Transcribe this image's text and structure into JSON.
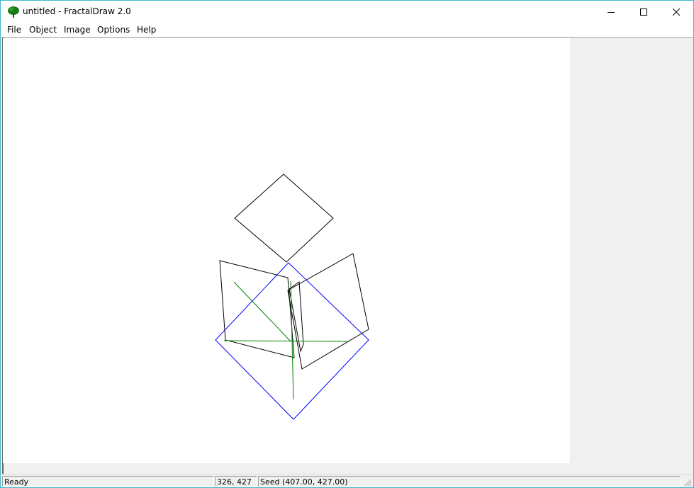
{
  "window": {
    "title": "untitled - FractalDraw 2.0",
    "app_icon": "tree-icon",
    "controls": [
      "minimize-icon",
      "maximize-icon",
      "close-icon"
    ]
  },
  "menu": {
    "items": [
      {
        "label": "File"
      },
      {
        "label": "Object"
      },
      {
        "label": "Image"
      },
      {
        "label": "Options"
      },
      {
        "label": "Help"
      }
    ]
  },
  "canvas": {
    "background": "#ffffff",
    "colors": {
      "shape": "#000000",
      "selection": "#0000ff",
      "axis": "#008000"
    }
  },
  "status": {
    "message": "Ready",
    "cursor": "326, 427",
    "seed": "Seed (407.00, 427.00)"
  }
}
